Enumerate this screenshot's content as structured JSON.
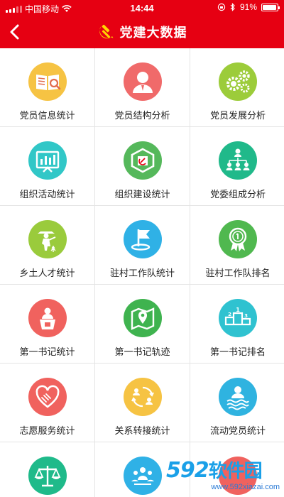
{
  "status_bar": {
    "carrier": "中国移动",
    "time": "14:44",
    "battery": "91%"
  },
  "nav": {
    "title": "党建大数据"
  },
  "grid": [
    {
      "label": "党员信息统计",
      "color": "#f6c343",
      "icon": "book-search-icon"
    },
    {
      "label": "党员结构分析",
      "color": "#f06a6a",
      "icon": "person-icon"
    },
    {
      "label": "党员发展分析",
      "color": "#9ccc3a",
      "icon": "gears-icon"
    },
    {
      "label": "组织活动统计",
      "color": "#31c7c7",
      "icon": "bar-chart-board-icon"
    },
    {
      "label": "组织建设统计",
      "color": "#55b85b",
      "icon": "party-cube-icon"
    },
    {
      "label": "党委组成分析",
      "color": "#20b98a",
      "icon": "org-chart-icon"
    },
    {
      "label": "乡土人才统计",
      "color": "#9acb3c",
      "icon": "farmer-icon"
    },
    {
      "label": "驻村工作队统计",
      "color": "#2fb1e6",
      "icon": "flag-icon"
    },
    {
      "label": "驻村工作队排名",
      "color": "#50b84f",
      "icon": "medal-icon"
    },
    {
      "label": "第一书记统计",
      "color": "#f0625e",
      "icon": "speaker-icon"
    },
    {
      "label": "第一书记轨迹",
      "color": "#3fb34f",
      "icon": "map-pin-icon"
    },
    {
      "label": "第一书记排名",
      "color": "#2fc2d0",
      "icon": "podium-icon"
    },
    {
      "label": "志愿服务统计",
      "color": "#f0625e",
      "icon": "heart-hands-icon"
    },
    {
      "label": "关系转接统计",
      "color": "#f6c343",
      "icon": "transfer-icon"
    },
    {
      "label": "流动党员统计",
      "color": "#2fb3e0",
      "icon": "person-waves-icon"
    },
    {
      "label": "",
      "color": "#1fba8a",
      "icon": "scales-icon"
    },
    {
      "label": "",
      "color": "#2fb1e6",
      "icon": "group-icon"
    },
    {
      "label": "",
      "color": "#f0625e",
      "icon": "circle-icon"
    }
  ],
  "watermark": {
    "logo_num": "592",
    "logo_cn": "软件园",
    "url": "www.592xiazai.com"
  }
}
